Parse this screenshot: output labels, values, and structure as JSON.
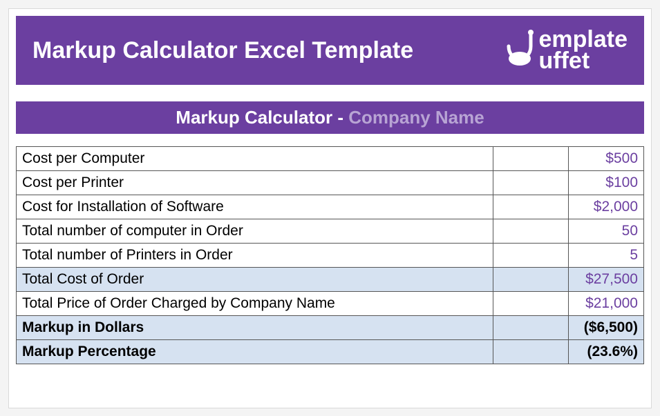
{
  "header": {
    "title": "Markup Calculator Excel Template",
    "logo_line1": "emplate",
    "logo_line2": "uffet"
  },
  "subheader": {
    "title": "Markup Calculator - ",
    "company": "Company Name"
  },
  "rows": [
    {
      "label": "Cost per Computer",
      "value": "$500",
      "shade": false,
      "bold": false,
      "purple": true
    },
    {
      "label": "Cost per Printer",
      "value": "$100",
      "shade": false,
      "bold": false,
      "purple": true
    },
    {
      "label": "Cost for Installation of Software",
      "value": "$2,000",
      "shade": false,
      "bold": false,
      "purple": true
    },
    {
      "label": "Total number of computer in Order",
      "value": "50",
      "shade": false,
      "bold": false,
      "purple": true
    },
    {
      "label": "Total number of Printers in Order",
      "value": "5",
      "shade": false,
      "bold": false,
      "purple": true
    },
    {
      "label": "Total Cost of Order",
      "value": "$27,500",
      "shade": true,
      "bold": false,
      "purple": true
    },
    {
      "label": "Total Price of Order Charged by Company Name",
      "value": "$21,000",
      "shade": false,
      "bold": false,
      "purple": true
    },
    {
      "label": "Markup in Dollars",
      "value": "($6,500)",
      "shade": true,
      "bold": true,
      "purple": false
    },
    {
      "label": "Markup Percentage",
      "value": "(23.6%)",
      "shade": true,
      "bold": true,
      "purple": false
    }
  ]
}
